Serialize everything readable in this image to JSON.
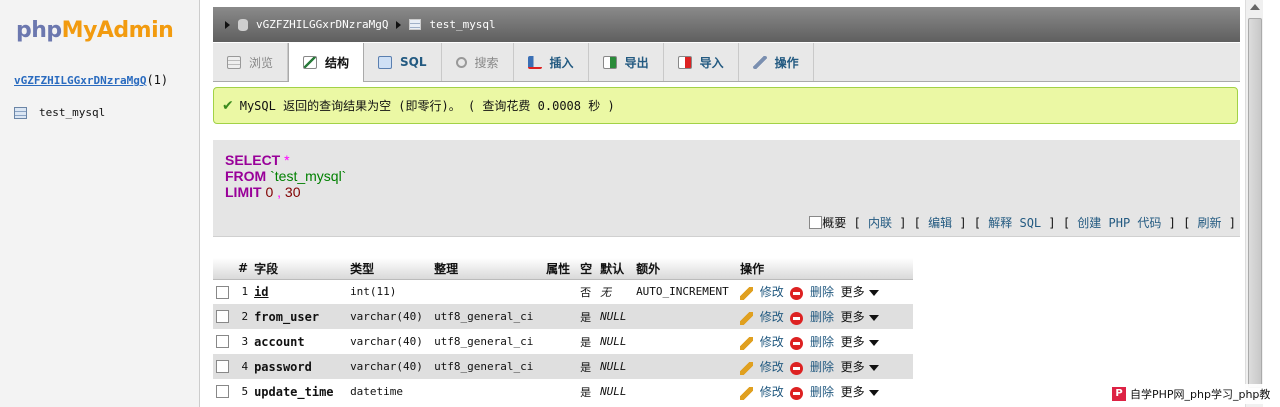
{
  "sidebar": {
    "logo_php": "php",
    "logo_admin": "MyAdmin",
    "database_name": "vGZFZHILGGxrDNzraMgQ",
    "database_count": "(1)",
    "table_name": "test_mysql"
  },
  "breadcrumb": {
    "database": "vGZFZHILGGxrDNzraMgQ",
    "table": "test_mysql"
  },
  "tabs": [
    {
      "label": "浏览",
      "icon": "browse-icon",
      "state": "disabled"
    },
    {
      "label": "结构",
      "icon": "structure-icon",
      "state": "active"
    },
    {
      "label": "SQL",
      "icon": "sql-icon",
      "state": "normal"
    },
    {
      "label": "搜索",
      "icon": "search-icon",
      "state": "disabled"
    },
    {
      "label": "插入",
      "icon": "insert-icon",
      "state": "normal"
    },
    {
      "label": "导出",
      "icon": "export-icon",
      "state": "normal"
    },
    {
      "label": "导入",
      "icon": "import-icon",
      "state": "normal"
    },
    {
      "label": "操作",
      "icon": "wrench-icon",
      "state": "normal"
    }
  ],
  "notice": {
    "text": "MySQL 返回的查询结果为空 (即零行)。 ( 查询花费 0.0008 秒 )"
  },
  "sql": {
    "select": "SELECT",
    "star": "*",
    "from": "FROM",
    "table": "`test_mysql`",
    "limit": "LIMIT",
    "offset": "0",
    "comma": ",",
    "count": "30"
  },
  "sql_links": {
    "profiling": "概要",
    "inline": "内联",
    "edit": "编辑",
    "explain": "解释 SQL",
    "create_php": "创建 PHP 代码",
    "refresh": "刷新"
  },
  "table": {
    "headers": [
      "#",
      "字段",
      "类型",
      "整理",
      "属性",
      "空",
      "默认",
      "额外",
      "操作"
    ],
    "action_edit": "修改",
    "action_delete": "删除",
    "action_more": "更多",
    "rows": [
      {
        "num": "1",
        "name": "id",
        "type": "int(11)",
        "collation": "",
        "null": "否",
        "default": "无",
        "extra": "AUTO_INCREMENT"
      },
      {
        "num": "2",
        "name": "from_user",
        "type": "varchar(40)",
        "collation": "utf8_general_ci",
        "null": "是",
        "default": "NULL",
        "extra": ""
      },
      {
        "num": "3",
        "name": "account",
        "type": "varchar(40)",
        "collation": "utf8_general_ci",
        "null": "是",
        "default": "NULL",
        "extra": ""
      },
      {
        "num": "4",
        "name": "password",
        "type": "varchar(40)",
        "collation": "utf8_general_ci",
        "null": "是",
        "default": "NULL",
        "extra": ""
      },
      {
        "num": "5",
        "name": "update_time",
        "type": "datetime",
        "collation": "",
        "null": "是",
        "default": "NULL",
        "extra": ""
      }
    ]
  },
  "watermark": {
    "text": "自学PHP网_php学习_php教"
  },
  "colors": {
    "accent_link": "#235a81",
    "notice_bg": "#ebf8a4",
    "keyword": "#990099"
  }
}
